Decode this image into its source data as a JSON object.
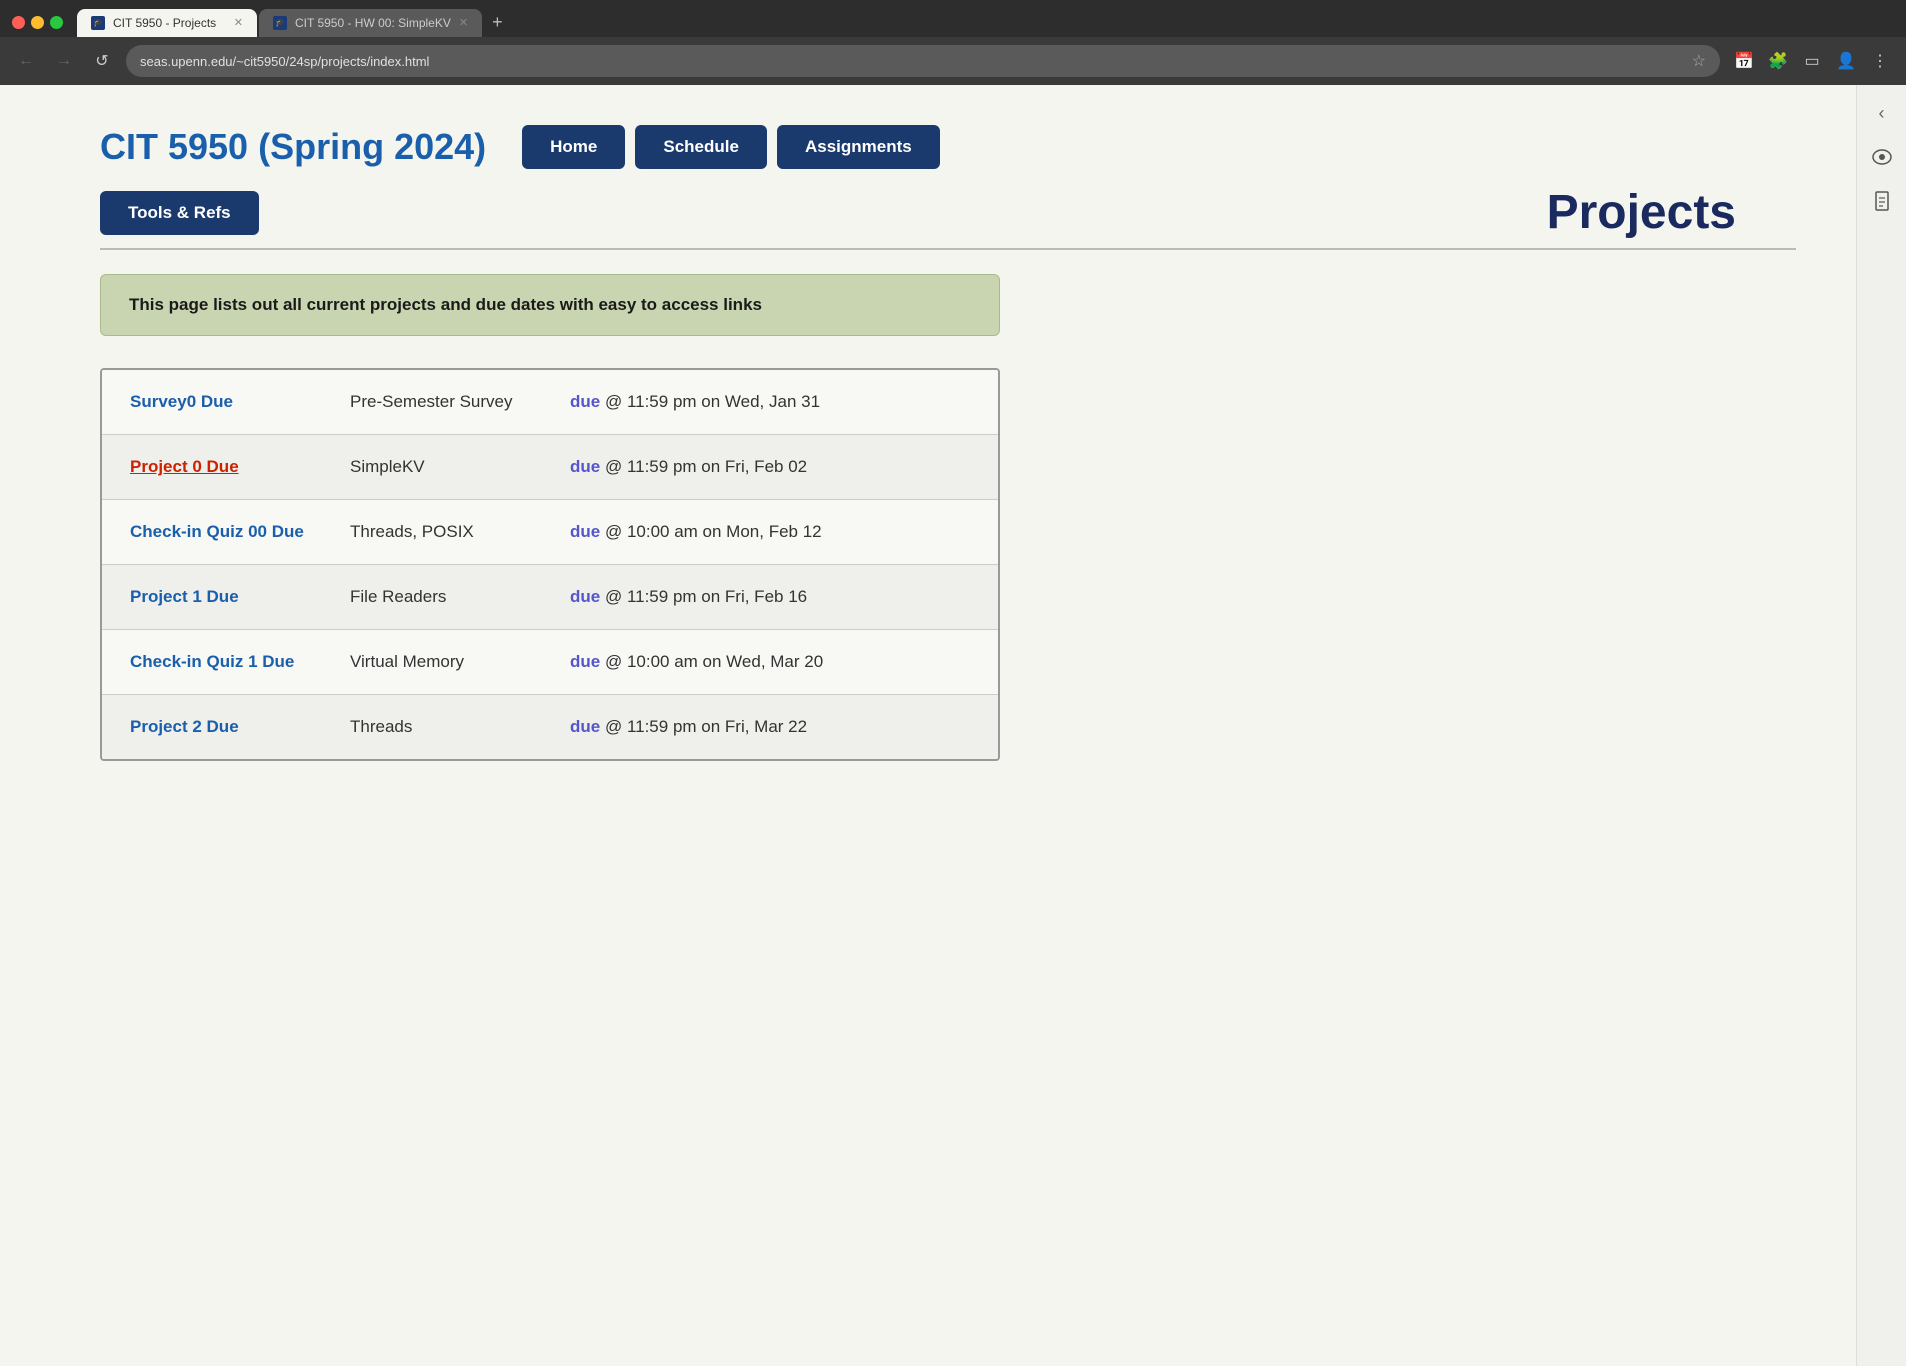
{
  "browser": {
    "tabs": [
      {
        "id": "tab1",
        "title": "CIT 5950 - Projects",
        "active": true,
        "favicon": "P"
      },
      {
        "id": "tab2",
        "title": "CIT 5950 - HW 00: SimpleKV",
        "active": false,
        "favicon": "H"
      }
    ],
    "address": "seas.upenn.edu/~cit5950/24sp/projects/index.html",
    "new_tab_label": "+",
    "back_label": "←",
    "forward_label": "→",
    "reload_label": "↺"
  },
  "site": {
    "title": "CIT 5950 (Spring 2024)",
    "nav": [
      {
        "label": "Home",
        "id": "home"
      },
      {
        "label": "Schedule",
        "id": "schedule"
      },
      {
        "label": "Assignments",
        "id": "assignments"
      },
      {
        "label": "Tools & Refs",
        "id": "tools"
      }
    ],
    "page_title": "Projects",
    "info_banner": "This page lists out all current projects and due dates with easy to access links",
    "projects": [
      {
        "name": "Survey0 Due",
        "topic": "Pre-Semester Survey",
        "due_label": "due",
        "due_rest": " @ 11:59 pm on Wed, Jan 31",
        "name_style": "blue"
      },
      {
        "name": "Project 0 Due",
        "topic": "SimpleKV",
        "due_label": "due",
        "due_rest": " @ 11:59 pm on Fri, Feb 02",
        "name_style": "red"
      },
      {
        "name": "Check-in Quiz 00 Due",
        "topic": "Threads, POSIX",
        "due_label": "due",
        "due_rest": " @ 10:00 am on Mon, Feb 12",
        "name_style": "blue"
      },
      {
        "name": "Project 1 Due",
        "topic": "File Readers",
        "due_label": "due",
        "due_rest": " @ 11:59 pm on Fri, Feb 16",
        "name_style": "blue"
      },
      {
        "name": "Check-in Quiz 1 Due",
        "topic": "Virtual Memory",
        "due_label": "due",
        "due_rest": " @ 10:00 am on Wed, Mar 20",
        "name_style": "blue"
      },
      {
        "name": "Project 2 Due",
        "topic": "Threads",
        "due_label": "due",
        "due_rest": " @ 11:59 pm on Fri, Mar 22",
        "name_style": "blue"
      }
    ]
  },
  "right_sidebar": {
    "icons": [
      "‹",
      "👁",
      "🖹"
    ]
  }
}
